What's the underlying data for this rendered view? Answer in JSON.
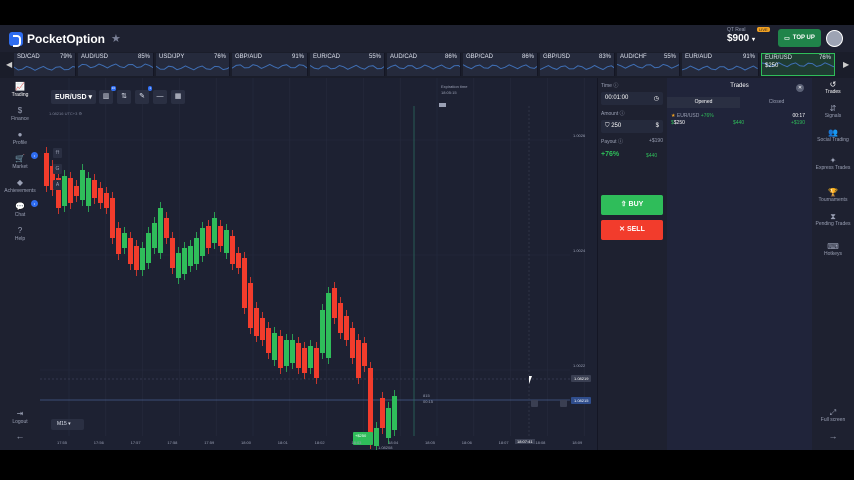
{
  "brand": {
    "name": "PocketOption"
  },
  "account": {
    "type": "QT Real",
    "balance": "$900",
    "badge": "LIVE",
    "topup_label": "TOP UP"
  },
  "ticker": [
    {
      "name": "SD/CAD",
      "pct": "79%"
    },
    {
      "name": "AUD/USD",
      "pct": "85%"
    },
    {
      "name": "USD/JPY",
      "pct": "76%"
    },
    {
      "name": "GBP/AUD",
      "pct": "91%"
    },
    {
      "name": "EUR/CAD",
      "pct": "55%"
    },
    {
      "name": "AUD/CAD",
      "pct": "86%"
    },
    {
      "name": "GBP/CAD",
      "pct": "86%"
    },
    {
      "name": "GBP/USD",
      "pct": "83%"
    },
    {
      "name": "AUD/CHF",
      "pct": "55%"
    },
    {
      "name": "EUR/AUD",
      "pct": "91%"
    },
    {
      "name": "EUR/USD",
      "pct": "76%",
      "amount": "$250"
    }
  ],
  "left_nav": [
    {
      "label": "Trading",
      "icon": "chart-icon"
    },
    {
      "label": "Finance",
      "icon": "dollar-icon"
    },
    {
      "label": "Profile",
      "icon": "user-icon"
    },
    {
      "label": "Market",
      "icon": "cart-icon"
    },
    {
      "label": "Achievements",
      "icon": "diamond-icon"
    },
    {
      "label": "Chat",
      "icon": "chat-icon"
    },
    {
      "label": "Help",
      "icon": "help-icon"
    },
    {
      "label": "Logout",
      "icon": "logout-icon"
    }
  ],
  "chart": {
    "pair": "EUR/USD",
    "tool_badges": [
      "10",
      "1"
    ],
    "utc_label": "UTC+3",
    "expiration_label": "Expiration time",
    "expiration_time": "18:05:15",
    "prices": [
      "1.0026",
      "1.0024",
      "1.0022"
    ],
    "price_markers": [
      "1.08219",
      "1.08215"
    ],
    "countdown": "815",
    "countdown_sub": "00:15",
    "trade_tag": "+$250",
    "last_price": "1.08208",
    "current_time": "18:07:41",
    "timeframe": "M15",
    "x_ticks": [
      "17:55",
      "17:56",
      "17:57",
      "17:58",
      "17:59",
      "18:00",
      "18:01",
      "18:02",
      "18:03",
      "18:04",
      "18:05",
      "18:06",
      "18:07",
      "18:08",
      "18:09"
    ],
    "colors": {
      "up": "#2fbd5a",
      "down": "#f23c2c"
    }
  },
  "chart_data": {
    "type": "candlestick",
    "x": [
      "17:55",
      "17:56",
      "17:57",
      "17:58",
      "17:59",
      "18:00",
      "18:01",
      "18:02",
      "18:03",
      "18:04"
    ],
    "ylim": [
      1.0021,
      1.0027
    ]
  },
  "trade_panel": {
    "time_label": "Time",
    "time": "00:01:00",
    "amount_label": "Amount",
    "amount": "250",
    "payout_label": "Payout",
    "payout_delta": "+$190",
    "payout_pct": "+76%",
    "payout_amount": "$440",
    "buy_label": "BUY",
    "sell_label": "SELL"
  },
  "trades": {
    "title": "Trades",
    "tab_opened": "Opened",
    "tab_closed": "Closed",
    "row": {
      "pair": "EUR/USD",
      "pct": "+76%",
      "amount": "$250",
      "payout": "$440",
      "time": "00:17",
      "profit": "+$190"
    }
  },
  "right_nav": [
    {
      "label": "Trades",
      "icon": "history-icon"
    },
    {
      "label": "Signals",
      "icon": "signal-icon"
    },
    {
      "label": "Social Trading",
      "icon": "people-icon"
    },
    {
      "label": "Express Trades",
      "icon": "express-icon"
    },
    {
      "label": "Tournaments",
      "icon": "trophy-icon"
    },
    {
      "label": "Pending Trades",
      "icon": "hourglass-icon"
    },
    {
      "label": "Hotkeys",
      "icon": "keyboard-icon"
    },
    {
      "label": "Full screen",
      "icon": "fullscreen-icon"
    }
  ]
}
